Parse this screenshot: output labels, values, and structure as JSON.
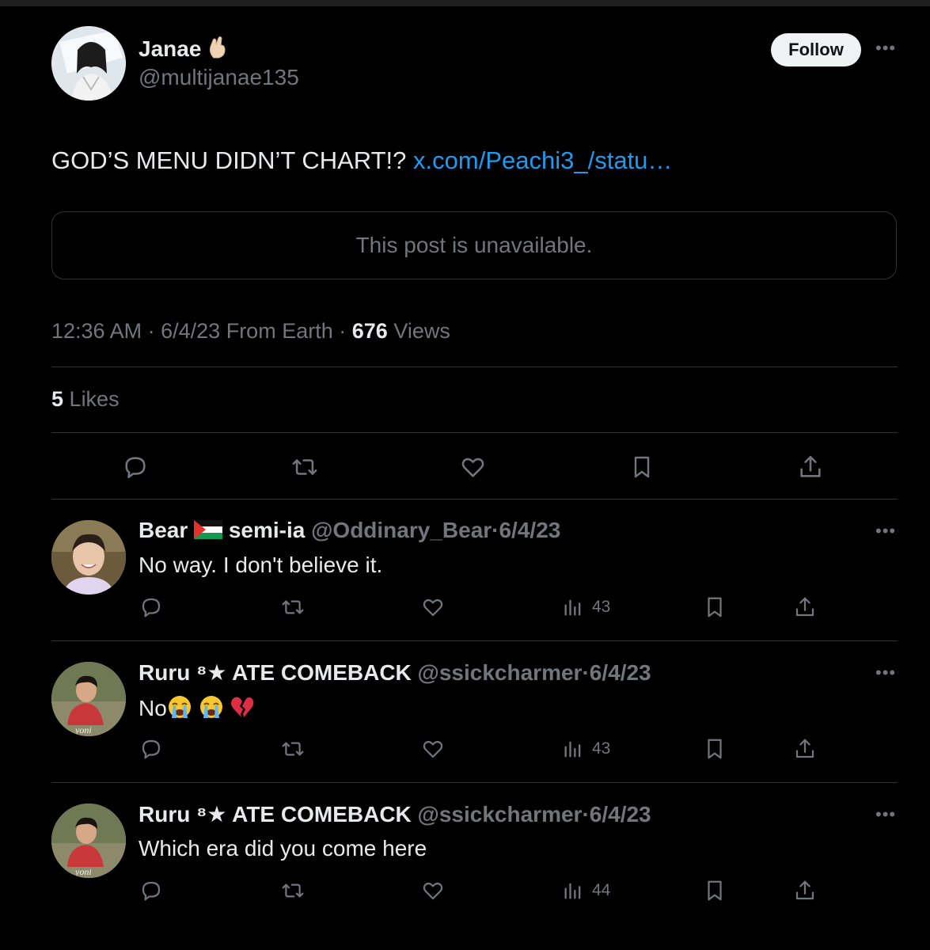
{
  "tweet": {
    "author": {
      "display_name": "Janae",
      "name_emoji": "hand-icon",
      "handle": "@multijanae135"
    },
    "follow_label": "Follow",
    "text": "GOD’S MENU DIDN’T CHART!?",
    "link": "x.com/Peachi3_/statu…",
    "quoted_post": "This post is unavailable.",
    "time": "12:36 AM",
    "date": "6/4/23",
    "location": "From Earth",
    "views_count": "676",
    "views_label": "Views",
    "likes_count": "5",
    "likes_label": "Likes",
    "separator": "·"
  },
  "replies": [
    {
      "name_part1": "Bear",
      "name_flag": "palestine-flag-icon",
      "name_part2": "semi-ia",
      "handle": "@Oddinary_Bear",
      "date": "6/4/23",
      "text": "No way. I don't believe it.",
      "views": "43"
    },
    {
      "name": "Ruru ⁸★ ATE COMEBACK",
      "handle": "@ssickcharmer",
      "date": "6/4/23",
      "text": "No",
      "emojis": [
        "crying-face-icon",
        "crying-face-icon",
        "broken-heart-icon"
      ],
      "views": "43"
    },
    {
      "name": "Ruru ⁸★ ATE COMEBACK",
      "handle": "@ssickcharmer",
      "date": "6/4/23",
      "text": "Which era did you come here",
      "views": "44"
    }
  ],
  "colors": {
    "background": "#000000",
    "text": "#e7e9ea",
    "muted": "#71767b",
    "link": "#1d9bf0",
    "divider": "#2f3336"
  }
}
